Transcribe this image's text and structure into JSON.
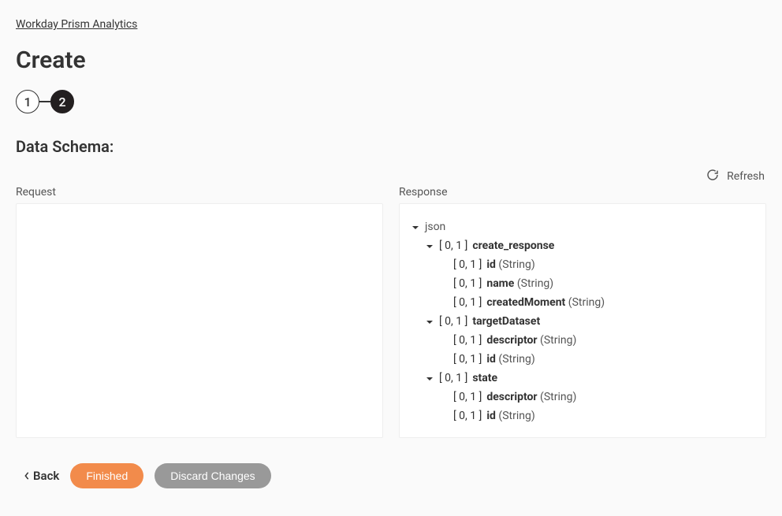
{
  "breadcrumb": "Workday Prism Analytics",
  "page_title": "Create",
  "stepper": {
    "step1": "1",
    "step2": "2"
  },
  "section_title": "Data Schema:",
  "refresh_label": "Refresh",
  "panels": {
    "request_label": "Request",
    "response_label": "Response"
  },
  "response_tree": {
    "root": "json",
    "create_response": {
      "label": "create_response",
      "cardinality": "[ 0, 1 ]",
      "fields": {
        "id": {
          "name": "id",
          "cardinality": "[ 0, 1 ]",
          "type": "(String)"
        },
        "name": {
          "name": "name",
          "cardinality": "[ 0, 1 ]",
          "type": "(String)"
        },
        "createdMoment": {
          "name": "createdMoment",
          "cardinality": "[ 0, 1 ]",
          "type": "(String)"
        }
      }
    },
    "targetDataset": {
      "label": "targetDataset",
      "cardinality": "[ 0, 1 ]",
      "fields": {
        "descriptor": {
          "name": "descriptor",
          "cardinality": "[ 0, 1 ]",
          "type": "(String)"
        },
        "id": {
          "name": "id",
          "cardinality": "[ 0, 1 ]",
          "type": "(String)"
        }
      }
    },
    "state": {
      "label": "state",
      "cardinality": "[ 0, 1 ]",
      "fields": {
        "descriptor": {
          "name": "descriptor",
          "cardinality": "[ 0, 1 ]",
          "type": "(String)"
        },
        "id": {
          "name": "id",
          "cardinality": "[ 0, 1 ]",
          "type": "(String)"
        }
      }
    }
  },
  "footer": {
    "back": "Back",
    "finished": "Finished",
    "discard": "Discard Changes"
  }
}
